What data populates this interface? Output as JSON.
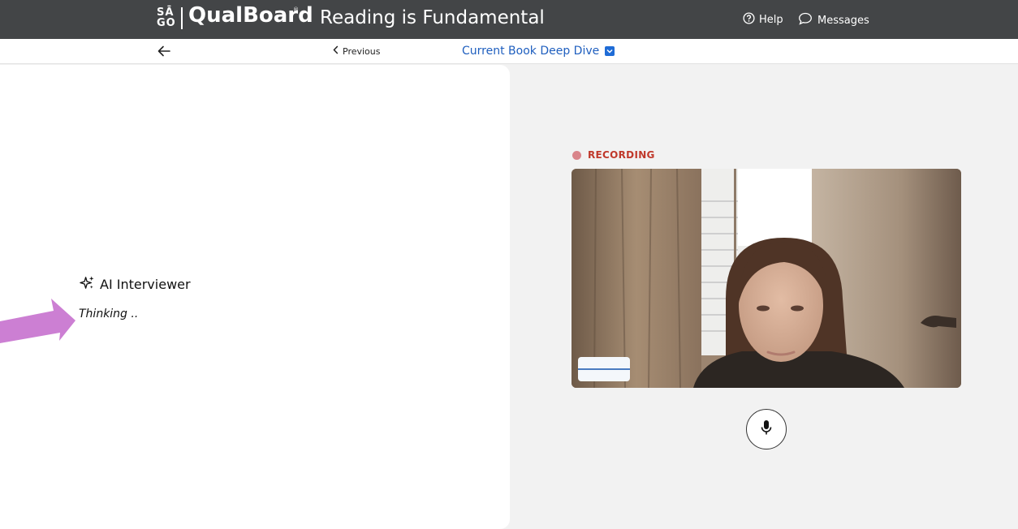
{
  "header": {
    "logo_top": "SĀ",
    "logo_bottom": "GO",
    "brand": "QualBoard",
    "brand_mark": "®",
    "title": "Reading is Fundamental",
    "help_label": "Help",
    "messages_label": "Messages"
  },
  "subnav": {
    "previous_label": "Previous",
    "activity_label": "Current Book Deep Dive"
  },
  "interviewer": {
    "label": "AI Interviewer",
    "status": "Thinking .."
  },
  "recording": {
    "label": "RECORDING"
  },
  "colors": {
    "header_bg": "#434547",
    "accent_blue": "#1f5fbf",
    "recording_red": "#c0392b",
    "annotation_pink": "#cc7fd3"
  },
  "icons": {
    "help": "question-circle-icon",
    "messages": "speech-bubble-icon",
    "back": "arrow-left-icon",
    "previous": "chevron-left-icon",
    "activity_dropdown": "chevron-down-icon",
    "ai": "sparkles-icon",
    "mic": "microphone-icon"
  }
}
